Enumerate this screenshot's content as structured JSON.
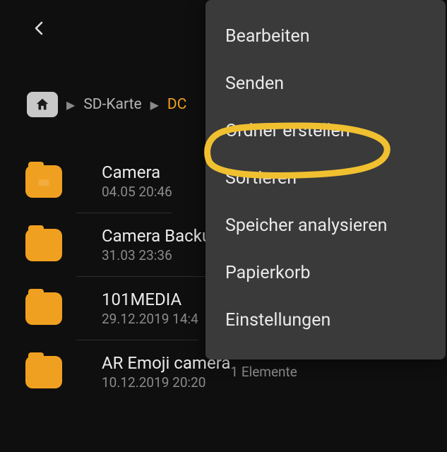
{
  "breadcrumb": {
    "items": [
      "SD-Karte",
      "DC"
    ],
    "current_index": 1
  },
  "folders": [
    {
      "name": "Camera",
      "date": "04.05 20:46",
      "count": ""
    },
    {
      "name": "Camera Backu",
      "date": "31.03 23:36",
      "count": ""
    },
    {
      "name": "101MEDIA",
      "date": "29.12.2019 14:4",
      "count": ""
    },
    {
      "name": "AR Emoji camera",
      "date": "10.12.2019 20:20",
      "count": "1 Elemente"
    }
  ],
  "menu": {
    "items": [
      "Bearbeiten",
      "Senden",
      "Ordner erstellen",
      "Sortieren",
      "Speicher analysieren",
      "Papierkorb",
      "Einstellungen"
    ],
    "highlighted_index": 2
  },
  "colors": {
    "accent": "#f0a020",
    "panel": "#3a3a3a",
    "bg": "#0f0f0f"
  }
}
